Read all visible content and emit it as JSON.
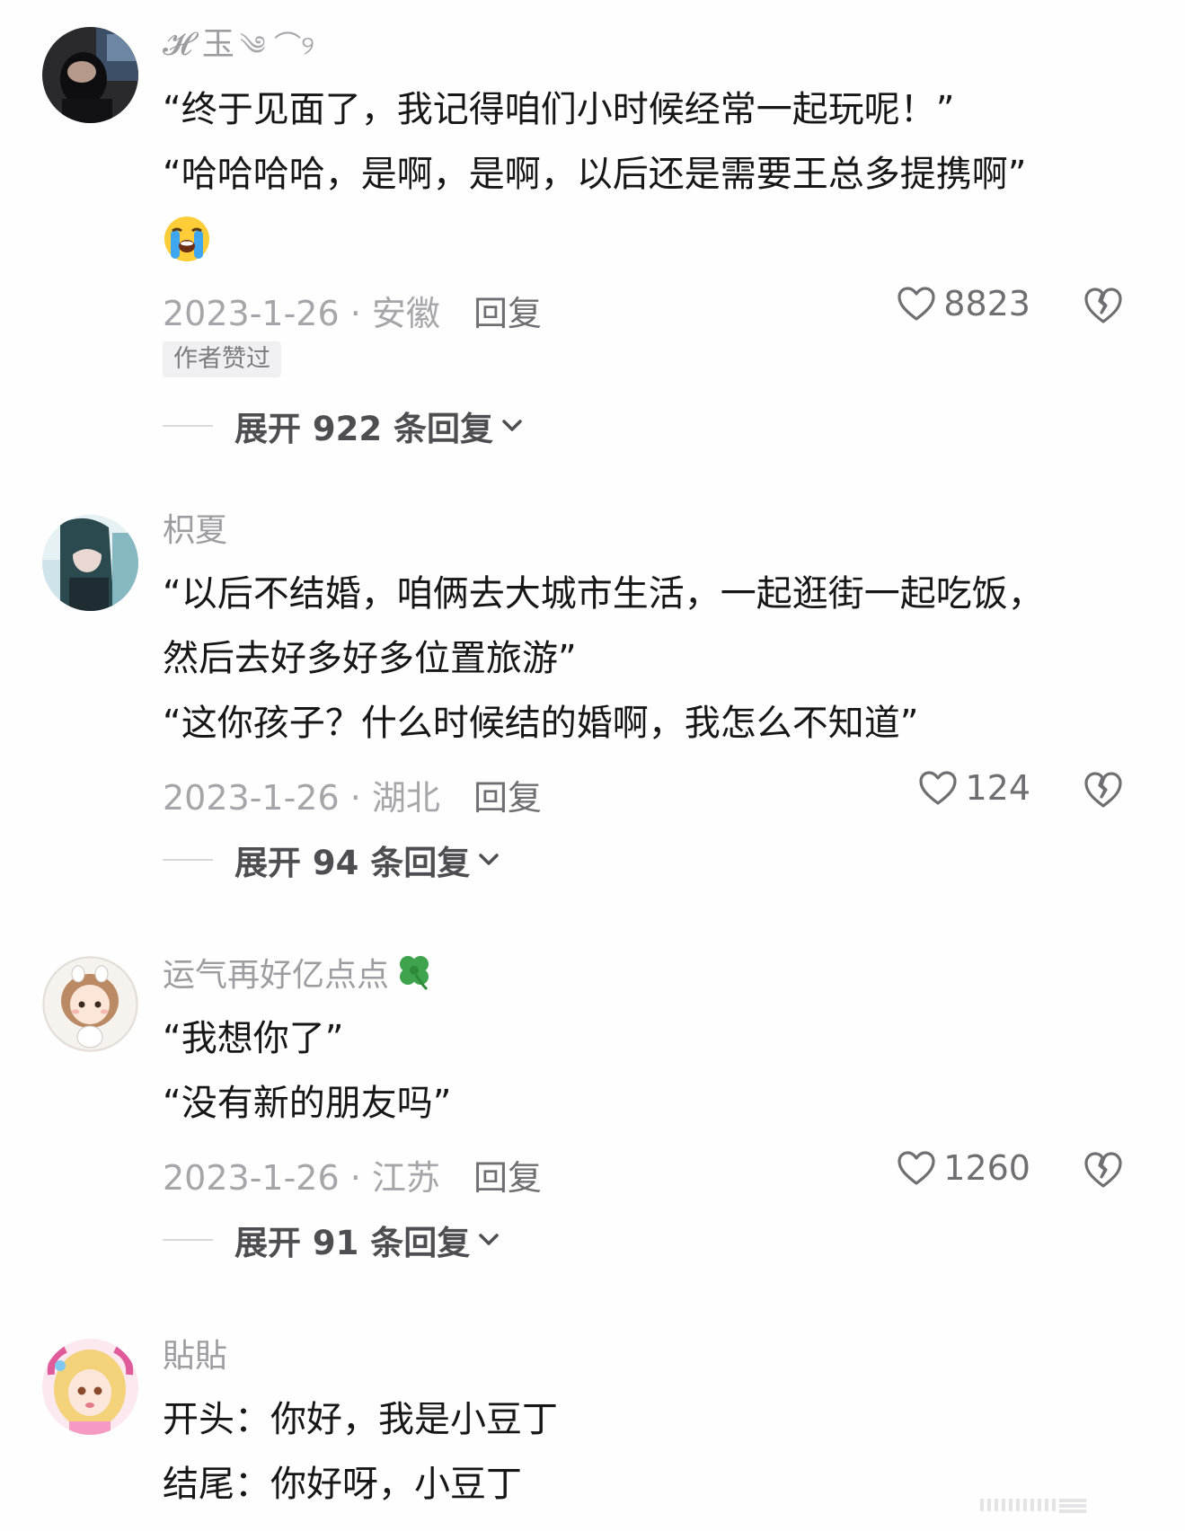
{
  "comments": [
    {
      "username": "𝓗 玉",
      "username_deco": "༄ ⌒୨",
      "lines": [
        "“终于见面了，我记得咱们小时候经常一起玩呢！”",
        "“哈哈哈哈，是啊，是啊，以后还是需要王总多提携啊”"
      ],
      "emoji": "loudly-crying-face-emoji",
      "date": "2023-1-26 · 安徽",
      "reply_label": "回复",
      "likes": "8823",
      "badge": "作者赞过",
      "expand_label": "展开 922 条回复"
    },
    {
      "username": "枳夏",
      "lines": [
        "“以后不结婚，咱俩去大城市生活，一起逛街一起吃饭，",
        "然后去好多好多位置旅游”",
        "“这你孩子？什么时候结的婚啊，我怎么不知道”"
      ],
      "date": "2023-1-26 · 湖北",
      "reply_label": "回复",
      "likes": "124",
      "expand_label": "展开 94 条回复"
    },
    {
      "username": "运气再好亿点点",
      "username_icon": "four-leaf-clover-icon",
      "lines": [
        "“我想你了”",
        "“没有新的朋友吗”"
      ],
      "date": "2023-1-26 · 江苏",
      "reply_label": "回复",
      "likes": "1260",
      "expand_label": "展开 91 条回复"
    },
    {
      "username": "貼貼",
      "lines": [
        "开头：你好，我是小豆丁",
        "结尾：你好呀，小豆丁"
      ]
    }
  ],
  "icons": {
    "like": "heart-outline-icon",
    "dislike": "broken-heart-icon",
    "expand": "chevron-down-icon"
  },
  "colors": {
    "text_primary": "#161616",
    "text_secondary": "#a6a6aa",
    "badge_bg": "#f0f0f2"
  }
}
